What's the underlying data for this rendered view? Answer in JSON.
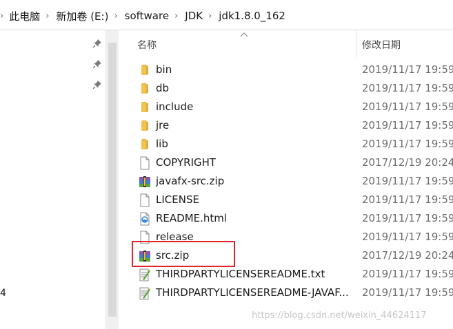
{
  "breadcrumb": {
    "items": [
      "此电脑",
      "新加卷 (E:)",
      "software",
      "JDK",
      "jdk1.8.0_162"
    ]
  },
  "columns": {
    "name": "名称",
    "date": "修改日期"
  },
  "nav": {
    "partial_text": "4"
  },
  "files": [
    {
      "name": "bin",
      "date": "2019/11/17 19:59",
      "type": "folder"
    },
    {
      "name": "db",
      "date": "2019/11/17 19:59",
      "type": "folder"
    },
    {
      "name": "include",
      "date": "2019/11/17 19:59",
      "type": "folder"
    },
    {
      "name": "jre",
      "date": "2019/11/17 19:59",
      "type": "folder"
    },
    {
      "name": "lib",
      "date": "2019/11/17 19:59",
      "type": "folder"
    },
    {
      "name": "COPYRIGHT",
      "date": "2017/12/19 20:24",
      "type": "file"
    },
    {
      "name": "javafx-src.zip",
      "date": "2019/11/17 19:59",
      "type": "zip"
    },
    {
      "name": "LICENSE",
      "date": "2019/11/17 19:59",
      "type": "file"
    },
    {
      "name": "README.html",
      "date": "2019/11/17 19:59",
      "type": "html"
    },
    {
      "name": "release",
      "date": "2019/11/17 19:59",
      "type": "file"
    },
    {
      "name": "src.zip",
      "date": "2017/12/19 20:24",
      "type": "zip"
    },
    {
      "name": "THIRDPARTYLICENSEREADME.txt",
      "date": "2019/11/17 19:59",
      "type": "txt"
    },
    {
      "name": "THIRDPARTYLICENSEREADME-JAVAF...",
      "date": "2019/11/17 19:59",
      "type": "txt"
    }
  ],
  "highlighted_file": "src.zip",
  "watermark": "https://blog.csdn.net/weixin_44624117",
  "colors": {
    "highlight_border": "#e3232b",
    "folder": "#f2c14e",
    "date_text": "#6d6d6d"
  }
}
